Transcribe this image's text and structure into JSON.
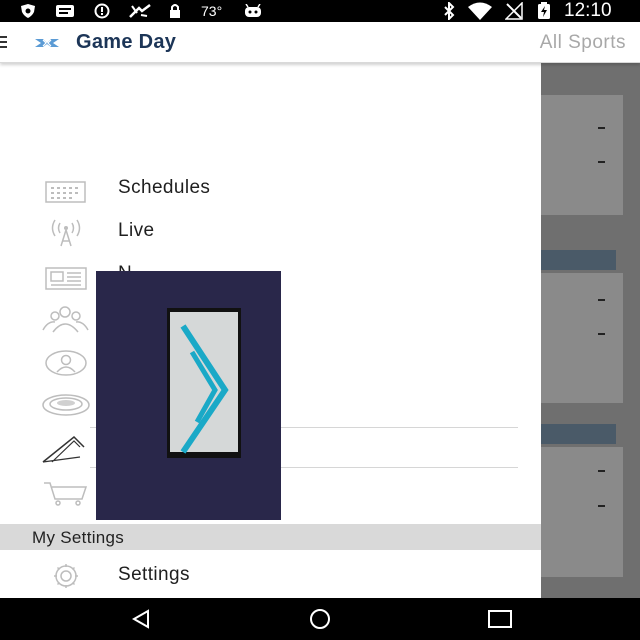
{
  "status_bar": {
    "temperature": "73°",
    "time": "12:10",
    "icons": [
      "shield-icon",
      "message-icon",
      "alert-circle-icon",
      "sports-icon",
      "lock-icon",
      "android-icon",
      "bluetooth-icon",
      "wifi-icon",
      "no-signal-icon",
      "battery-charging-icon"
    ]
  },
  "app_bar": {
    "menu_icon": "hamburger-menu-icon",
    "logo_icon": "nc-logo-icon",
    "title": "Game Day",
    "sports_link": "All Sports"
  },
  "drawer": {
    "items": [
      {
        "icon": "calendar-icon",
        "label": "Schedules"
      },
      {
        "icon": "broadcast-icon",
        "label": "Live"
      },
      {
        "icon": "newspaper-icon",
        "label": "N"
      },
      {
        "icon": "users-icon",
        "label": ""
      },
      {
        "icon": "person-circle-icon",
        "label": ""
      },
      {
        "icon": "stadium-icon",
        "label": ""
      },
      {
        "icon": "tickets-icon",
        "label": ""
      },
      {
        "icon": "cart-icon",
        "label": ""
      }
    ],
    "section_header": "My Settings",
    "settings": {
      "icon": "gear-icon",
      "label": "Settings"
    }
  },
  "ad": {
    "logo_icon": "play-triangle-logo-icon"
  },
  "nav_bar": {
    "icons": [
      "back-icon",
      "home-icon",
      "recents-icon"
    ]
  },
  "colors": {
    "title": "#1c3557",
    "logo": "#5b9bd5",
    "ad_background": "#29274a",
    "ad_logo": "#1aa9c7",
    "section_header": "#d9d9d9",
    "scrim": "#6f6f6f"
  }
}
